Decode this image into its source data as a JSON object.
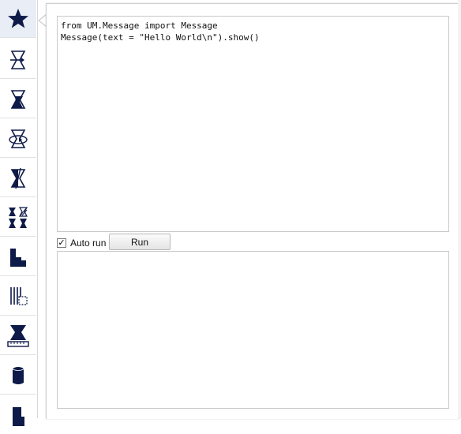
{
  "toolbar": {
    "items": [
      {
        "icon": "star-icon",
        "active": true
      },
      {
        "icon": "translate-icon"
      },
      {
        "icon": "scale-icon"
      },
      {
        "icon": "rotate-icon"
      },
      {
        "icon": "mirror-icon"
      },
      {
        "icon": "per-model-settings-icon"
      },
      {
        "icon": "support-blocker-icon"
      },
      {
        "icon": "mesh-tools-icon"
      },
      {
        "icon": "measure-icon"
      },
      {
        "icon": "cylinder-icon"
      },
      {
        "icon": "shape-icon"
      }
    ]
  },
  "editor": {
    "code_lines": [
      "from UM.Message import Message",
      "Message(text = \"Hello World\\n\").show()"
    ]
  },
  "controls": {
    "autorun_label": "Auto run",
    "autorun_checked": true,
    "checkmark": "✓",
    "run_label": "Run"
  },
  "output": {
    "text": ""
  },
  "colors": {
    "icon": "#0e1a48",
    "active_bg": "#e9eef6",
    "border": "#c9c9c9"
  }
}
